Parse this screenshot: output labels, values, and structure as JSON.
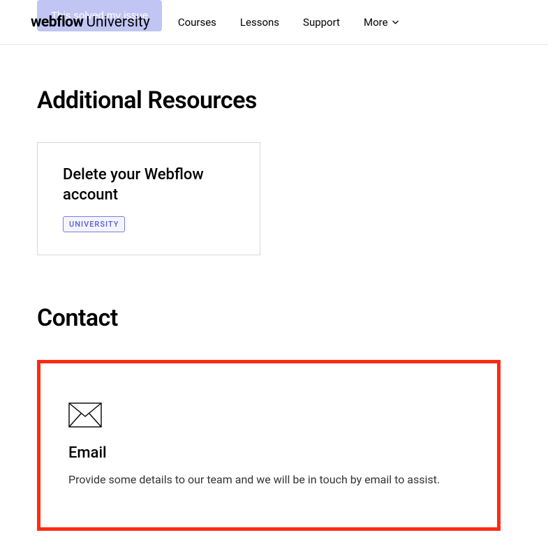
{
  "header": {
    "logo_main": "webflow",
    "logo_sub": "University",
    "solved_button": "This solved my issue",
    "nav": {
      "courses": "Courses",
      "lessons": "Lessons",
      "support": "Support",
      "more": "More"
    }
  },
  "resources": {
    "title": "Additional Resources",
    "card": {
      "title": "Delete your Webflow account",
      "badge": "UNIVERSITY"
    }
  },
  "contact": {
    "title": "Contact",
    "email": {
      "title": "Email",
      "description": "Provide some details to our team and we will be in touch by email to assist."
    }
  }
}
